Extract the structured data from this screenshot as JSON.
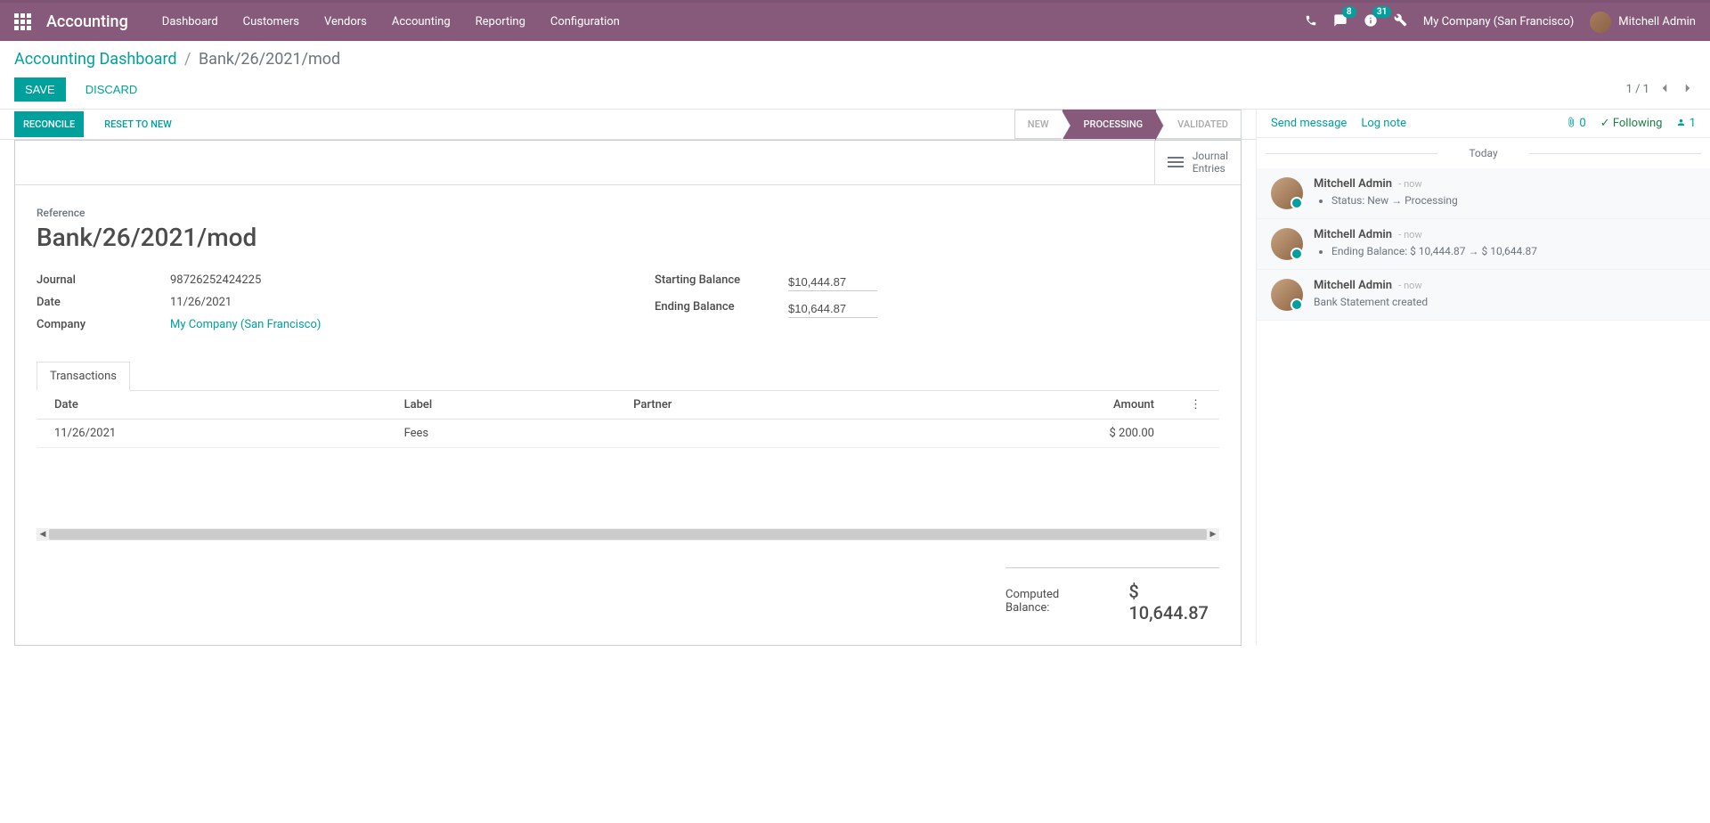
{
  "navbar": {
    "brand": "Accounting",
    "menu": [
      "Dashboard",
      "Customers",
      "Vendors",
      "Accounting",
      "Reporting",
      "Configuration"
    ],
    "messages_badge": "8",
    "activities_badge": "31",
    "company": "My Company (San Francisco)",
    "user": "Mitchell Admin"
  },
  "breadcrumb": {
    "parent": "Accounting Dashboard",
    "current": "Bank/26/2021/mod"
  },
  "buttons": {
    "save": "Save",
    "discard": "Discard",
    "reconcile": "Reconcile",
    "reset": "Reset to New"
  },
  "pager": {
    "text": "1 / 1"
  },
  "status": {
    "new": "New",
    "processing": "Processing",
    "validated": "Validated"
  },
  "stat": {
    "journal_entries": "Journal Entries"
  },
  "form": {
    "reference_label": "Reference",
    "reference_value": "Bank/26/2021/mod",
    "journal_label": "Journal",
    "journal_value": "98726252424225",
    "date_label": "Date",
    "date_value": "11/26/2021",
    "company_label": "Company",
    "company_value": "My Company (San Francisco)",
    "starting_balance_label": "Starting Balance",
    "starting_balance_value": "$10,444.87",
    "ending_balance_label": "Ending Balance",
    "ending_balance_value": "$10,644.87"
  },
  "tabs": {
    "transactions": "Transactions"
  },
  "table": {
    "headers": {
      "date": "Date",
      "label": "Label",
      "partner": "Partner",
      "amount": "Amount"
    },
    "rows": [
      {
        "date": "11/26/2021",
        "label": "Fees",
        "partner": "",
        "amount": "$ 200.00"
      }
    ]
  },
  "summary": {
    "label": "Computed Balance:",
    "value": "$ 10,644.87"
  },
  "chatter": {
    "send_message": "Send message",
    "log_note": "Log note",
    "attach_count": "0",
    "following": "Following",
    "followers_count": "1",
    "today": "Today",
    "messages": [
      {
        "author": "Mitchell Admin",
        "time": "- now",
        "items": [
          "Status: New → Processing"
        ]
      },
      {
        "author": "Mitchell Admin",
        "time": "- now",
        "items": [
          "Ending Balance: $ 10,444.87 → $ 10,644.87"
        ]
      },
      {
        "author": "Mitchell Admin",
        "time": "- now",
        "text": "Bank Statement created"
      }
    ]
  }
}
